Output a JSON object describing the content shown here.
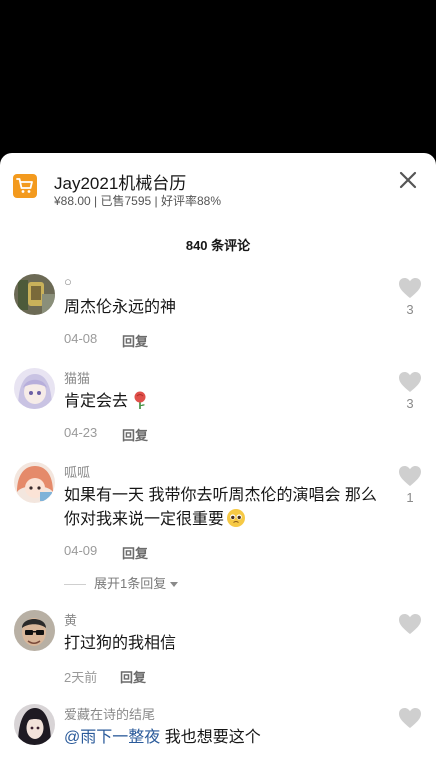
{
  "product": {
    "title": "Jay2021机械台历",
    "meta": "¥88.00 | 已售7595 | 好评率88%",
    "icon": "shopping-cart-icon"
  },
  "comments_header": {
    "count_label": "840 条评论"
  },
  "comments": [
    {
      "name": "○",
      "text": "周杰伦永远的神",
      "date": "04-08",
      "reply_label": "回复",
      "likes": "3"
    },
    {
      "name": "猫猫",
      "text": "肯定会去",
      "emoji": "rose-icon",
      "date": "04-23",
      "reply_label": "回复",
      "likes": "3"
    },
    {
      "name": "呱呱",
      "text": "如果有一天 我带你去听周杰伦的演唱会 那么你对我来说一定很重要",
      "emoji": "pleading-face-icon",
      "date": "04-09",
      "reply_label": "回复",
      "likes": "1",
      "expand_label": "展开1条回复"
    },
    {
      "name": "黄",
      "text": "打过狗的我相信",
      "date": "2天前",
      "reply_label": "回复",
      "likes": ""
    },
    {
      "name": "爱藏在诗的结尾",
      "mention": "@雨下一整夜",
      "text": " 我也想要这个",
      "likes": ""
    }
  ],
  "colors": {
    "accent_orange": "#f39a1e",
    "mention_blue": "#2a5a9a",
    "heart_gray": "#cfcfcf"
  }
}
